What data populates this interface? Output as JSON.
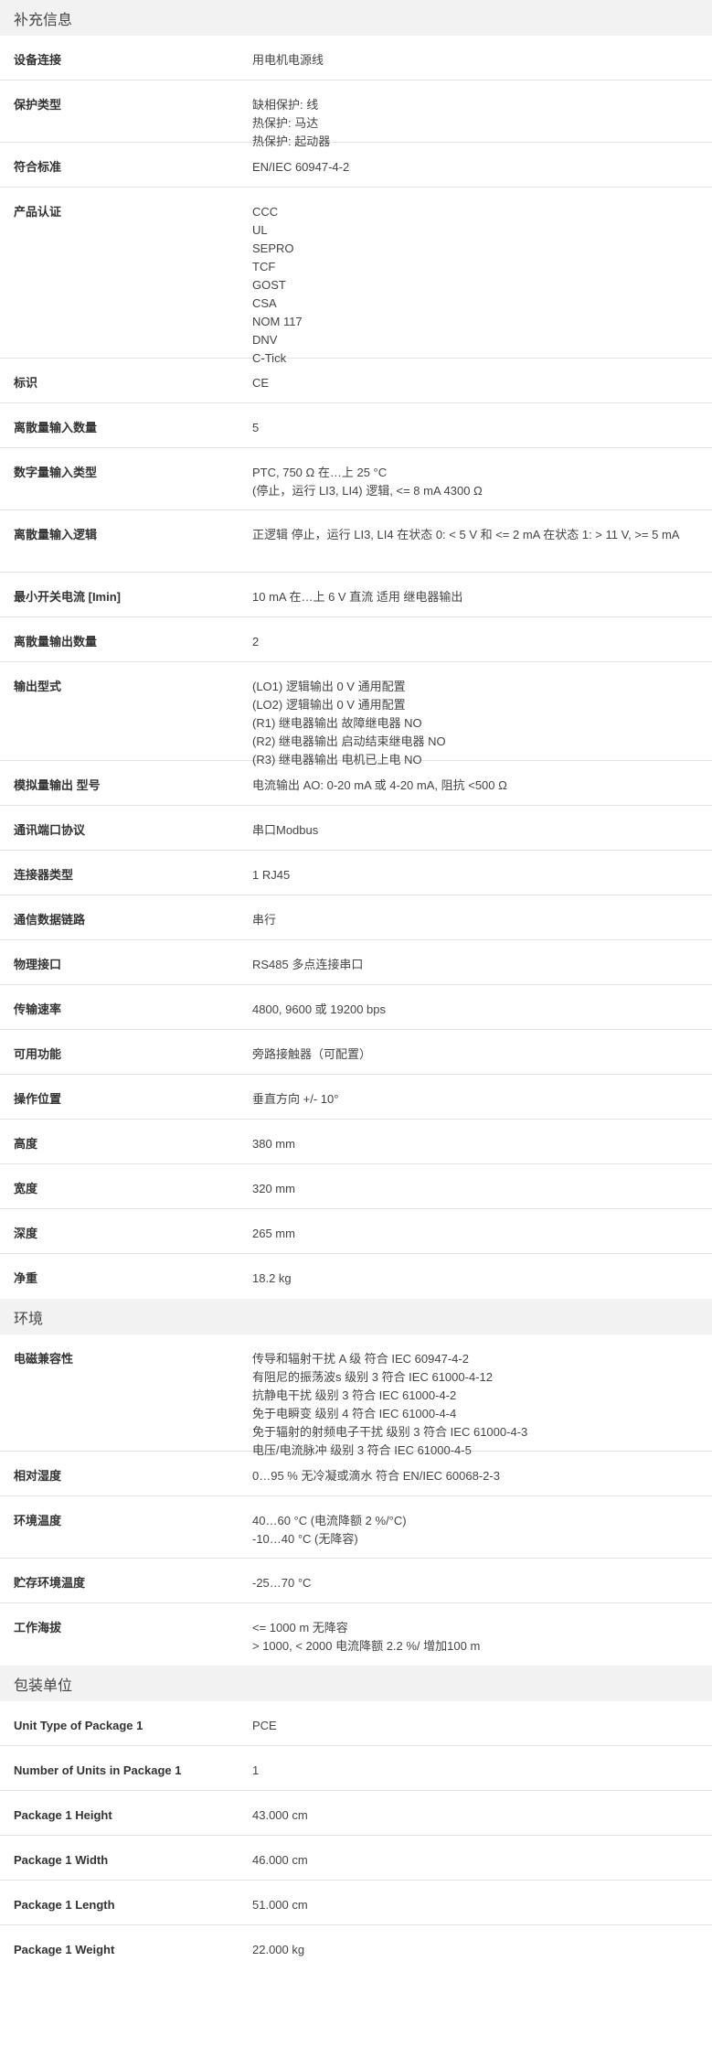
{
  "sections": [
    {
      "title": "补充信息",
      "rows": [
        {
          "label": "设备连接",
          "values": [
            "用电机电源线"
          ]
        },
        {
          "label": "保护类型",
          "values": [
            "缺相保护: 线",
            "热保护: 马达",
            "热保护: 起动器"
          ]
        },
        {
          "label": "符合标准",
          "values": [
            "EN/IEC 60947-4-2"
          ]
        },
        {
          "label": "产品认证",
          "values": [
            "CCC",
            "UL",
            "SEPRO",
            "TCF",
            "GOST",
            "CSA",
            "NOM 117",
            "DNV",
            "C-Tick"
          ]
        },
        {
          "label": "标识",
          "values": [
            "CE"
          ]
        },
        {
          "label": "离散量输入数量",
          "values": [
            "5"
          ]
        },
        {
          "label": "数字量输入类型",
          "values": [
            "PTC, 750 Ω 在…上 25 °C",
            "(停止，运行 LI3, LI4) 逻辑, <= 8 mA 4300 Ω"
          ]
        },
        {
          "label": "离散量输入逻辑",
          "values": [
            "正逻辑 停止，运行 LI3, LI4 在状态 0: < 5 V 和 <= 2 mA 在状态 1: > 11 V, >= 5 mA"
          ]
        },
        {
          "label": "最小开关电流 [Imin]",
          "values": [
            "10 mA 在…上 6 V 直流 适用 继电器输出"
          ]
        },
        {
          "label": "离散量输出数量",
          "values": [
            "2"
          ]
        },
        {
          "label": "输出型式",
          "values": [
            "(LO1) 逻辑输出 0 V 通用配置",
            "(LO2) 逻辑输出 0 V 通用配置",
            "(R1) 继电器输出 故障继电器 NO",
            "(R2) 继电器输出 启动结束继电器 NO",
            "(R3) 继电器输出 电机已上电 NO"
          ]
        },
        {
          "label": "模拟量输出 型号",
          "values": [
            "电流输出 AO: 0-20 mA 或 4-20 mA, 阻抗 <500 Ω"
          ]
        },
        {
          "label": "通讯端口协议",
          "values": [
            "串口Modbus"
          ]
        },
        {
          "label": "连接器类型",
          "values": [
            "1 RJ45"
          ]
        },
        {
          "label": "通信数据链路",
          "values": [
            "串行"
          ]
        },
        {
          "label": "物理接口",
          "values": [
            "RS485 多点连接串口"
          ]
        },
        {
          "label": "传输速率",
          "values": [
            "4800, 9600 或 19200 bps"
          ]
        },
        {
          "label": "可用功能",
          "values": [
            "旁路接触器（可配置）"
          ]
        },
        {
          "label": "操作位置",
          "values": [
            "垂直方向 +/- 10°"
          ]
        },
        {
          "label": "高度",
          "values": [
            "380 mm"
          ]
        },
        {
          "label": "宽度",
          "values": [
            "320 mm"
          ]
        },
        {
          "label": "深度",
          "values": [
            "265 mm"
          ]
        },
        {
          "label": "净重",
          "values": [
            "18.2 kg"
          ]
        }
      ]
    },
    {
      "title": "环境",
      "rows": [
        {
          "label": "电磁兼容性",
          "values": [
            "传导和辐射干扰 A 级 符合 IEC 60947-4-2",
            "有阻尼的振荡波s 级别 3 符合 IEC 61000-4-12",
            "抗静电干扰 级别 3 符合 IEC 61000-4-2",
            "免于电瞬变 级别 4 符合 IEC 61000-4-4",
            "免于辐射的射频电子干扰 级别 3 符合 IEC 61000-4-3",
            "电压/电流脉冲 级别 3 符合 IEC 61000-4-5"
          ]
        },
        {
          "label": "相对湿度",
          "values": [
            "0…95 % 无冷凝或滴水 符合 EN/IEC 60068-2-3"
          ]
        },
        {
          "label": "环境温度",
          "values": [
            "40…60 °C (电流降额 2 %/°C)",
            "-10…40 °C (无降容)"
          ]
        },
        {
          "label": "贮存环境温度",
          "values": [
            "-25…70 °C"
          ]
        },
        {
          "label": "工作海拔",
          "values": [
            "<= 1000 m 无降容",
            "> 1000, < 2000 电流降额 2.2 %/ 增加100 m"
          ]
        }
      ]
    },
    {
      "title": "包装单位",
      "rows": [
        {
          "label": "Unit Type of Package 1",
          "values": [
            "PCE"
          ]
        },
        {
          "label": "Number of Units in Package 1",
          "values": [
            "1"
          ]
        },
        {
          "label": "Package 1 Height",
          "values": [
            "43.000 cm"
          ]
        },
        {
          "label": "Package 1 Width",
          "values": [
            "46.000 cm"
          ]
        },
        {
          "label": "Package 1 Length",
          "values": [
            "51.000 cm"
          ]
        },
        {
          "label": "Package 1 Weight",
          "values": [
            "22.000 kg"
          ]
        }
      ]
    }
  ]
}
